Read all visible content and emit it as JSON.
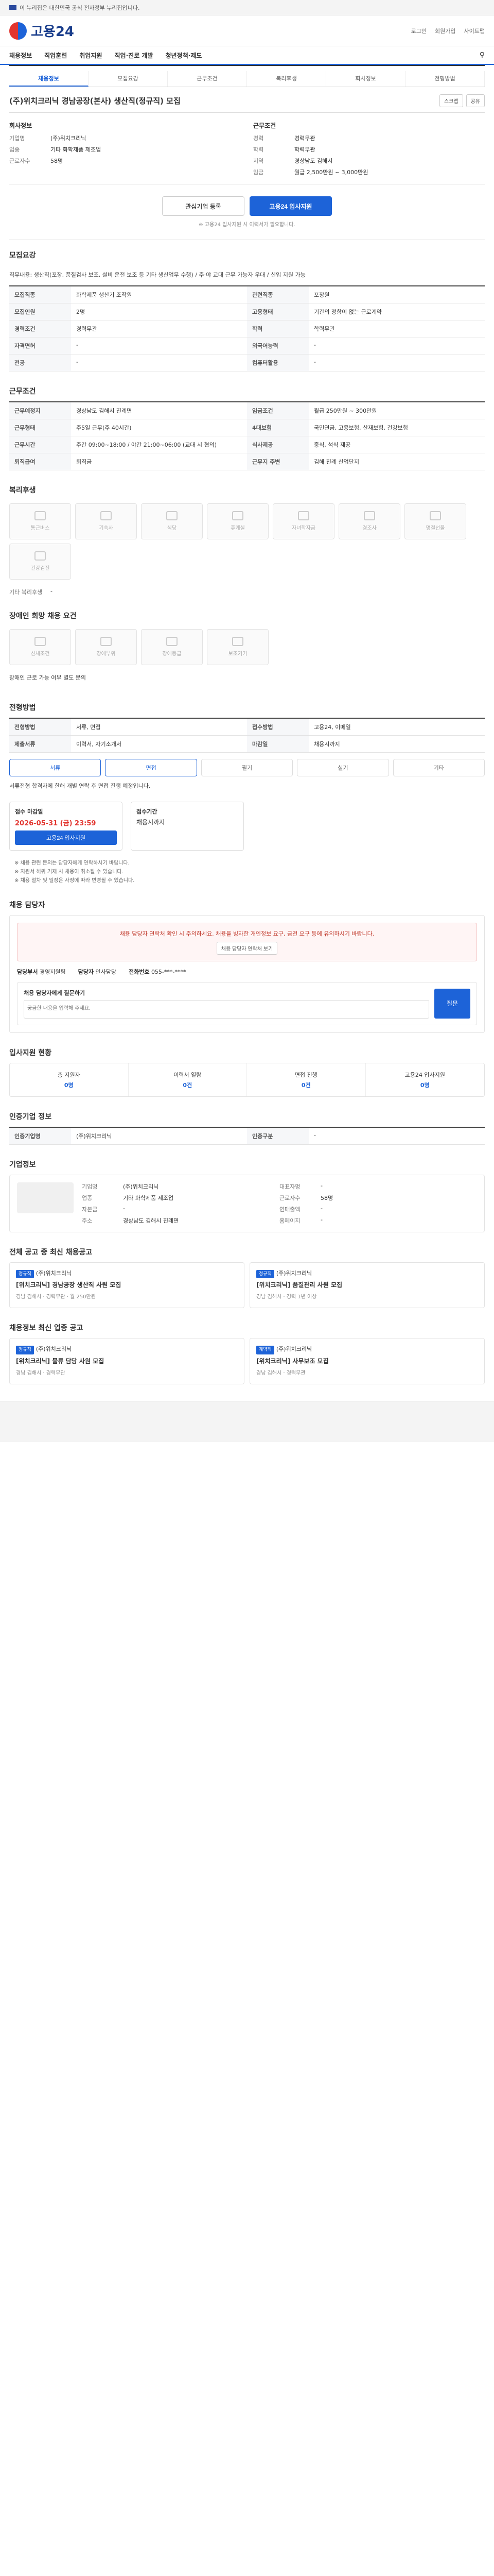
{
  "topbar": {
    "notice": "이 누리집은 대한민국 공식 전자정부 누리집입니다."
  },
  "header": {
    "logo": "고용24",
    "links": [
      "로그인",
      "회원가입",
      "사이트맵"
    ]
  },
  "nav": {
    "items": [
      "채용정보",
      "직업훈련",
      "취업지원",
      "직업·진로 개발",
      "청년정책·제도"
    ]
  },
  "subtabs": [
    "채용정보",
    "모집요강",
    "근무조건",
    "복리후생",
    "회사정보",
    "전형방법"
  ],
  "job": {
    "title": "(주)위치크리닉 경남공장(본사) 생산직(정규직) 모집",
    "btn_scrap": "스크랩",
    "btn_share": "공유",
    "company_h": "회사정보",
    "company": [
      [
        "기업명",
        "(주)위치크리닉"
      ],
      [
        "업종",
        "기타 화학제품 제조업"
      ],
      [
        "근로자수",
        "58명"
      ]
    ],
    "work_h": "근무조건",
    "work": [
      [
        "경력",
        "경력무관"
      ],
      [
        "학력",
        "학력무관"
      ],
      [
        "지역",
        "경상남도 김해시"
      ],
      [
        "임금",
        "월급 2,500만원 ~ 3,000만원"
      ]
    ]
  },
  "apply": {
    "btn_interest": "관심기업 등록",
    "btn_apply": "고용24 입사지원",
    "note": "※ 고용24 입사지원 시 이력서가 필요합니다."
  },
  "recruit": {
    "h": "모집요강",
    "desc": "직무내용: 생산직(포장, 품질검사 보조, 설비 운전 보조 등 기타 생산업무 수행) / 주·야 교대 근무 가능자 우대 / 신입 지원 가능",
    "rows": [
      [
        "모집직종",
        "화학제품 생산기 조작원",
        "관련직종",
        "포장원"
      ],
      [
        "모집인원",
        "2명",
        "고용형태",
        "기간의 정함이 없는 근로계약"
      ],
      [
        "경력조건",
        "경력무관",
        "학력",
        "학력무관"
      ],
      [
        "자격면허",
        "-",
        "외국어능력",
        "-"
      ],
      [
        "전공",
        "-",
        "컴퓨터활용",
        "-"
      ]
    ]
  },
  "cond": {
    "h": "근무조건",
    "rows": [
      [
        "근무예정지",
        "경상남도 김해시 진례면",
        "임금조건",
        "월급 250만원 ~ 300만원"
      ],
      [
        "근무형태",
        "주5일 근무(주 40시간)",
        "4대보험",
        "국민연금, 고용보험, 산재보험, 건강보험"
      ],
      [
        "근무시간",
        "주간 09:00~18:00 / 야간 21:00~06:00 (교대 시 협의)",
        "식사제공",
        "중식, 석식 제공"
      ],
      [
        "퇴직급여",
        "퇴직금",
        "근무지 주변",
        "김해 진례 산업단지"
      ]
    ]
  },
  "welfare": {
    "h": "복리후생",
    "items": [
      "통근버스",
      "기숙사",
      "식당",
      "휴게실",
      "자녀학자금",
      "경조사",
      "명절선물",
      "건강검진"
    ],
    "other_h": "기타 복리후생",
    "other": "-"
  },
  "disabled": {
    "h": "장애인 희망 채용 요건",
    "items": [
      "신체조건",
      "장애부위",
      "장애등급",
      "보조기기"
    ],
    "note": "장애인 근로 가능 여부 별도 문의"
  },
  "method": {
    "h": "전형방법",
    "rows": [
      [
        "전형방법",
        "서류, 면접",
        "접수방법",
        "고용24, 이메일"
      ],
      [
        "제출서류",
        "이력서, 자기소개서",
        "마감일",
        "채용시까지"
      ]
    ],
    "pills": [
      "서류",
      "면접",
      "필기",
      "실기",
      "기타"
    ],
    "pill_on": [
      "서류",
      "면접"
    ],
    "text": "서류전형 합격자에 한해 개별 연락 후 면접 진행 예정입니다.",
    "deadline_h": "접수 마감일",
    "deadline": "2026-05-31 (금) 23:59",
    "apply_btn": "고용24 입사지원",
    "period_h": "접수기간",
    "period": "채용시까지",
    "notes": [
      "※ 채용 관련 문의는 담당자에게 연락하시기 바랍니다.",
      "※ 지원서 허위 기재 시 채용이 취소될 수 있습니다.",
      "※ 채용 절차 및 일정은 사정에 따라 변경될 수 있습니다."
    ]
  },
  "manager": {
    "h": "채용 담당자",
    "alert": "채용 담당자 연락처 확인 시 주의하세요. 채용을 빙자한 개인정보 요구, 금전 요구 등에 유의하시기 바랍니다.",
    "alert_btn": "채용 담당자 연락처 보기",
    "dept_k": "담당부서",
    "dept": "경영지원팀",
    "name_k": "담당자",
    "name": "인사담당",
    "phone_k": "전화번호",
    "phone": "055-***-****",
    "qa_h": "채용 담당자에게 질문하기",
    "qa_ph": "궁금한 내용을 입력해 주세요.",
    "qa_btn": "질문"
  },
  "support": {
    "h": "입사지원 현황",
    "items": [
      [
        "총 지원자",
        "0명"
      ],
      [
        "이력서 열람",
        "0건"
      ],
      [
        "면접 진행",
        "0건"
      ],
      [
        "고용24 입사지원",
        "0명"
      ]
    ]
  },
  "certified": {
    "h": "인증기업 정보",
    "rows": [
      [
        "인증기업명",
        "(주)위치크리닉",
        "인증구분",
        "-"
      ]
    ]
  },
  "companyinfo": {
    "h": "기업정보",
    "rows": [
      [
        "기업명",
        "(주)위치크리닉"
      ],
      [
        "대표자명",
        "-"
      ],
      [
        "업종",
        "기타 화학제품 제조업"
      ],
      [
        "근로자수",
        "58명"
      ],
      [
        "자본금",
        "-"
      ],
      [
        "연매출액",
        "-"
      ],
      [
        "주소",
        "경상남도 김해시 진례면"
      ],
      [
        "홈페이지",
        "-"
      ]
    ]
  },
  "related": {
    "h": "전체 공고 중 최신 채용공고",
    "cards": [
      {
        "badge": "정규직",
        "company": "(주)위치크리닉",
        "title": "[위치크리닉] 경남공장 생산직 사원 모집",
        "meta": "경남 김해시 · 경력무관 · 월 250만원"
      },
      {
        "badge": "정규직",
        "company": "(주)위치크리닉",
        "title": "[위치크리닉] 품질관리 사원 모집",
        "meta": "경남 김해시 · 경력 1년 이상"
      },
      {
        "badge": "정규직",
        "company": "(주)위치크리닉",
        "title": "[위치크리닉] 물류 담당 사원 모집",
        "meta": "경남 김해시 · 경력무관"
      },
      {
        "badge": "계약직",
        "company": "(주)위치크리닉",
        "title": "[위치크리닉] 사무보조 모집",
        "meta": "경남 김해시 · 경력무관"
      }
    ]
  },
  "similar": {
    "h": "채용정보 최신 업종 공고"
  }
}
